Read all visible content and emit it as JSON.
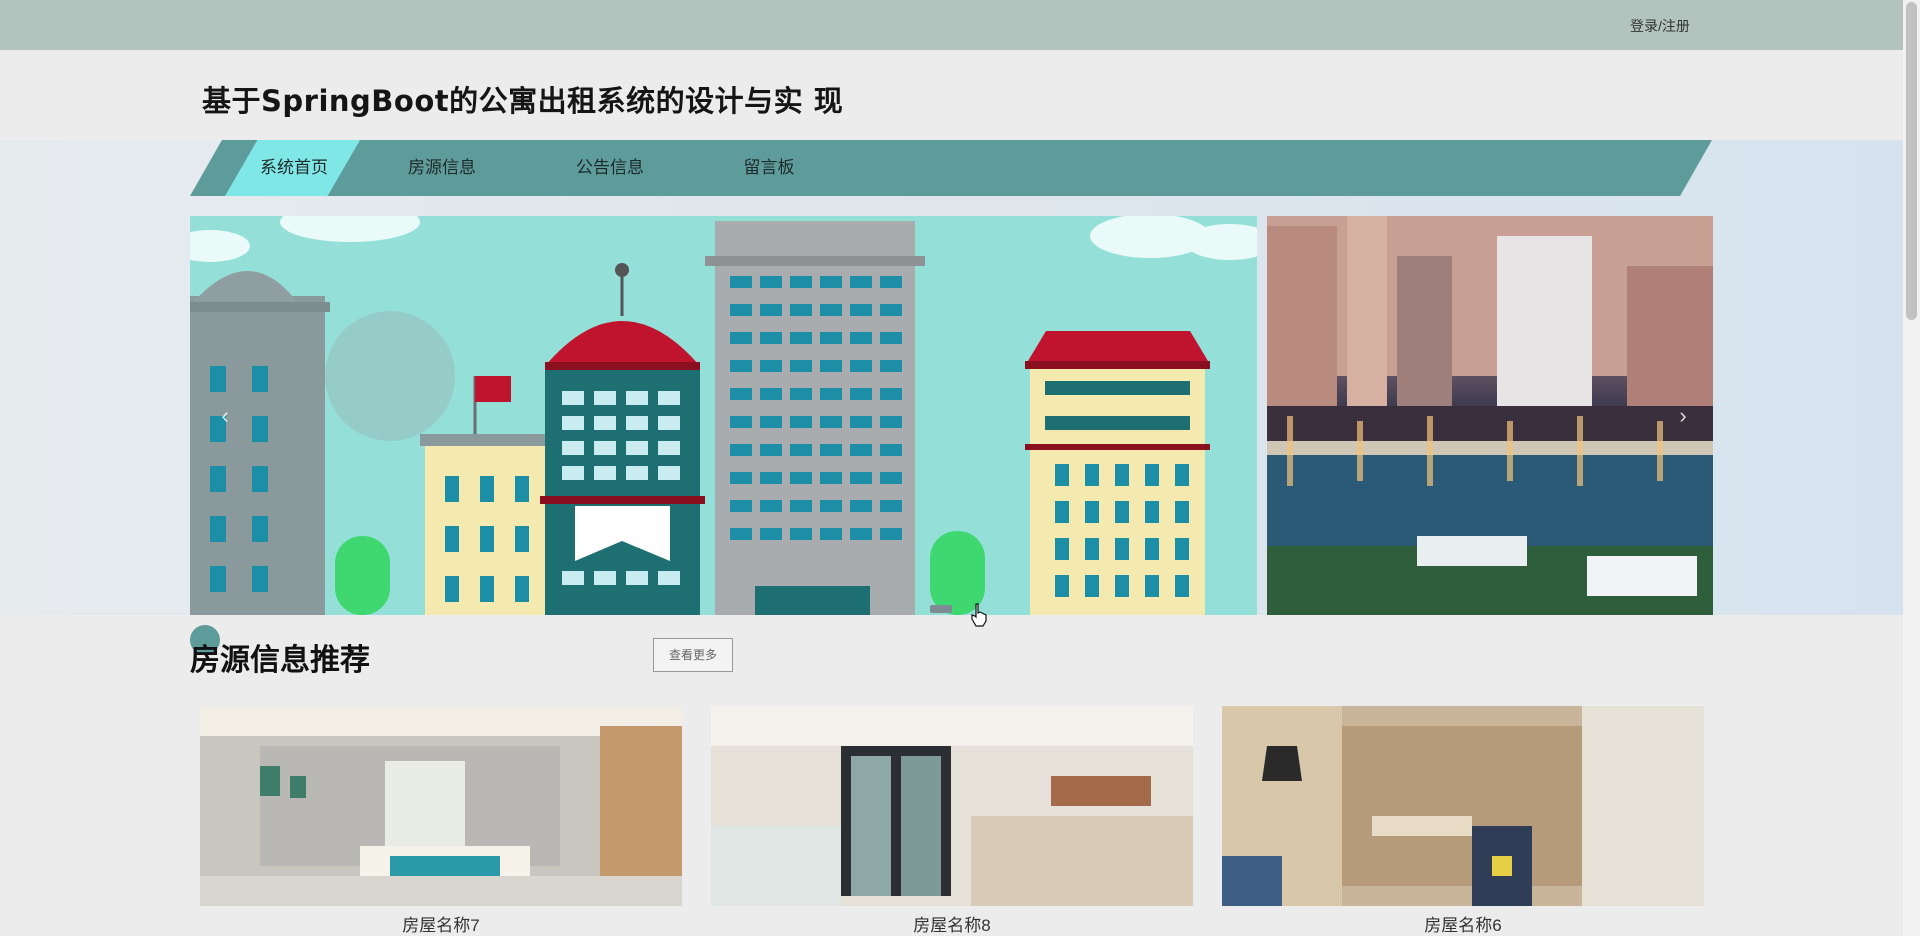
{
  "header": {
    "login_label": "登录/注册",
    "site_title": "基于SpringBoot的公寓出租系统的设计与实 现"
  },
  "nav": {
    "items": [
      {
        "label": "系统首页",
        "active": true
      },
      {
        "label": "房源信息",
        "active": false
      },
      {
        "label": "公告信息",
        "active": false
      },
      {
        "label": "留言板",
        "active": false
      }
    ]
  },
  "carousel": {
    "prev_icon": "chevron-left-icon",
    "next_icon": "chevron-right-icon",
    "dot_count": 3,
    "active_dot": 0
  },
  "section": {
    "title": "房源信息推荐",
    "more_label": "查看更多"
  },
  "cards": [
    {
      "name": "房屋名称7"
    },
    {
      "name": "房屋名称8"
    },
    {
      "name": "房屋名称6"
    }
  ],
  "colors": {
    "topbar": "#b3c4bf",
    "nav": "#5e9c9b",
    "nav_active": "#7fe7e6"
  }
}
